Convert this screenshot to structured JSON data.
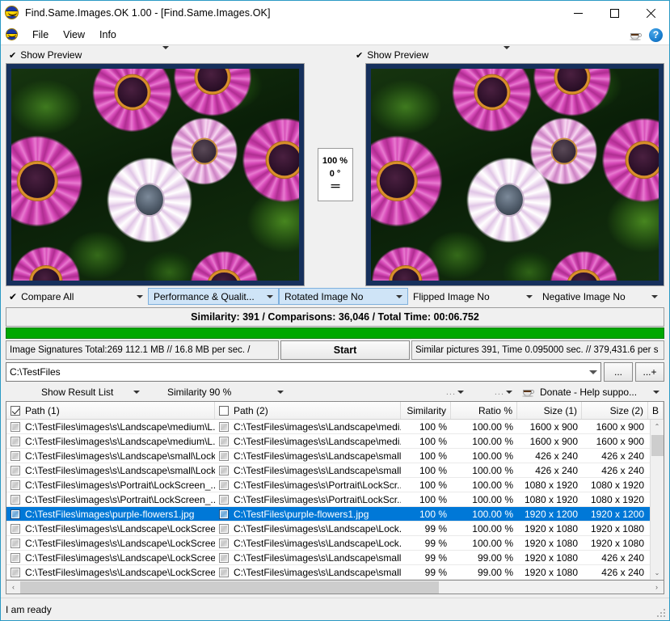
{
  "window": {
    "title": "Find.Same.Images.OK 1.00 - [Find.Same.Images.OK]",
    "app_icon": "smiley-icon",
    "minimize_label": "–",
    "maximize_label": "□",
    "close_label": "✕"
  },
  "menu": {
    "app_icon": "smiley-icon",
    "items": [
      {
        "label": "File"
      },
      {
        "label": "View"
      },
      {
        "label": "Info"
      }
    ],
    "right_icons": [
      {
        "name": "coffee-icon"
      },
      {
        "name": "help-icon",
        "label": "?"
      }
    ]
  },
  "preview": {
    "left": {
      "check": "✔",
      "label": "Show Preview",
      "arrow": "▼"
    },
    "right": {
      "check": "✔",
      "label": "Show Preview",
      "arrow": "▼"
    },
    "middle": {
      "percent": "100 %",
      "angle": "0 °",
      "equal": "=="
    }
  },
  "options_bar": [
    {
      "name": "compare-all",
      "check": "✔",
      "label": "Compare All",
      "highlight": false
    },
    {
      "name": "performance-quality",
      "label": "Performance & Qualit...",
      "highlight": true
    },
    {
      "name": "rotated-image",
      "label": "Rotated Image No",
      "highlight": true
    },
    {
      "name": "flipped-image",
      "label": "Flipped Image No",
      "highlight": false
    },
    {
      "name": "negative-image",
      "label": "Negative Image No",
      "highlight": false
    }
  ],
  "similarity_bar": {
    "text": "Similarity: 391 / Comparisons: 36,046 / Total Time: 00:06.752",
    "progress_color": "#00a800",
    "progress_percent": 100
  },
  "stats": {
    "left": "Image Signatures Total:269  112.1 MB // 16.8 MB per sec. /",
    "start_label": "Start",
    "right": "Similar pictures 391, Time 0.095000 sec. // 379,431.6 per s"
  },
  "path": {
    "value": "C:\\TestFiles",
    "browse_label": "...",
    "browse_add_label": "...+"
  },
  "result_options": [
    {
      "name": "show-result-list",
      "label": "Show Result List"
    },
    {
      "name": "similarity-threshold",
      "label": "Similarity 90 %"
    },
    {
      "name": "extra-options-1",
      "label": "..."
    },
    {
      "name": "extra-options-2",
      "label": "..."
    },
    {
      "name": "donate",
      "label": "Donate - Help suppo...",
      "icon": "coffee-icon"
    }
  ],
  "table": {
    "columns": [
      {
        "key": "path1",
        "label": "Path (1)",
        "checkbox": true,
        "checked": true
      },
      {
        "key": "path2",
        "label": "Path (2)",
        "checkbox": true,
        "checked": false
      },
      {
        "key": "similarity",
        "label": "Similarity"
      },
      {
        "key": "ratio",
        "label": "Ratio %"
      },
      {
        "key": "size1",
        "label": "Size (1)"
      },
      {
        "key": "size2",
        "label": "Size (2)"
      },
      {
        "key": "b",
        "label": "B"
      }
    ],
    "rows": [
      {
        "path1": "C:\\TestFiles\\images\\s\\Landscape\\medium\\L...",
        "path2": "C:\\TestFiles\\images\\s\\Landscape\\medi...",
        "similarity": "100 %",
        "ratio": "100.00 %",
        "size1": "1600 x 900",
        "size2": "1600 x 900",
        "b": "",
        "selected": false
      },
      {
        "path1": "C:\\TestFiles\\images\\s\\Landscape\\medium\\L...",
        "path2": "C:\\TestFiles\\images\\s\\Landscape\\medi...",
        "similarity": "100 %",
        "ratio": "100.00 %",
        "size1": "1600 x 900",
        "size2": "1600 x 900",
        "b": "",
        "selected": false
      },
      {
        "path1": "C:\\TestFiles\\images\\s\\Landscape\\small\\Lock...",
        "path2": "C:\\TestFiles\\images\\s\\Landscape\\small...",
        "similarity": "100 %",
        "ratio": "100.00 %",
        "size1": "426 x 240",
        "size2": "426 x 240",
        "b": "",
        "selected": false
      },
      {
        "path1": "C:\\TestFiles\\images\\s\\Landscape\\small\\Lock...",
        "path2": "C:\\TestFiles\\images\\s\\Landscape\\small...",
        "similarity": "100 %",
        "ratio": "100.00 %",
        "size1": "426 x 240",
        "size2": "426 x 240",
        "b": "",
        "selected": false
      },
      {
        "path1": "C:\\TestFiles\\images\\s\\Portrait\\LockScreen_...",
        "path2": "C:\\TestFiles\\images\\s\\Portrait\\LockScr...",
        "similarity": "100 %",
        "ratio": "100.00 %",
        "size1": "1080 x 1920",
        "size2": "1080 x 1920",
        "b": "",
        "selected": false
      },
      {
        "path1": "C:\\TestFiles\\images\\s\\Portrait\\LockScreen_...",
        "path2": "C:\\TestFiles\\images\\s\\Portrait\\LockScr...",
        "similarity": "100 %",
        "ratio": "100.00 %",
        "size1": "1080 x 1920",
        "size2": "1080 x 1920",
        "b": "",
        "selected": false
      },
      {
        "path1": "C:\\TestFiles\\images\\purple-flowers1.jpg",
        "path2": "C:\\TestFiles\\purple-flowers1.jpg",
        "similarity": "100 %",
        "ratio": "100.00 %",
        "size1": "1920 x 1200",
        "size2": "1920 x 1200",
        "b": "",
        "selected": true
      },
      {
        "path1": "C:\\TestFiles\\images\\s\\Landscape\\LockScree...",
        "path2": "C:\\TestFiles\\images\\s\\Landscape\\Lock...",
        "similarity": "99 %",
        "ratio": "100.00 %",
        "size1": "1920 x 1080",
        "size2": "1920 x 1080",
        "b": "",
        "selected": false
      },
      {
        "path1": "C:\\TestFiles\\images\\s\\Landscape\\LockScree...",
        "path2": "C:\\TestFiles\\images\\s\\Landscape\\Lock...",
        "similarity": "99 %",
        "ratio": "100.00 %",
        "size1": "1920 x 1080",
        "size2": "1920 x 1080",
        "b": "",
        "selected": false
      },
      {
        "path1": "C:\\TestFiles\\images\\s\\Landscape\\LockScree...",
        "path2": "C:\\TestFiles\\images\\s\\Landscape\\small...",
        "similarity": "99 %",
        "ratio": "99.00 %",
        "size1": "1920 x 1080",
        "size2": "426 x 240",
        "b": "",
        "selected": false
      },
      {
        "path1": "C:\\TestFiles\\images\\s\\Landscape\\LockScree",
        "path2": "C:\\TestFiles\\images\\s\\Landscape\\small",
        "similarity": "99 %",
        "ratio": "99.00 %",
        "size1": "1920 x 1080",
        "size2": "426 x 240",
        "b": "",
        "selected": false
      }
    ],
    "scroll_up": "⌃",
    "scroll_down": "⌄",
    "scroll_left": "‹",
    "scroll_right": "›"
  },
  "status": {
    "text": "I am ready"
  },
  "colors": {
    "selection": "#0078d7",
    "progress": "#00a800",
    "image_frame": "#16305c",
    "window_border": "#2b9ac4"
  }
}
